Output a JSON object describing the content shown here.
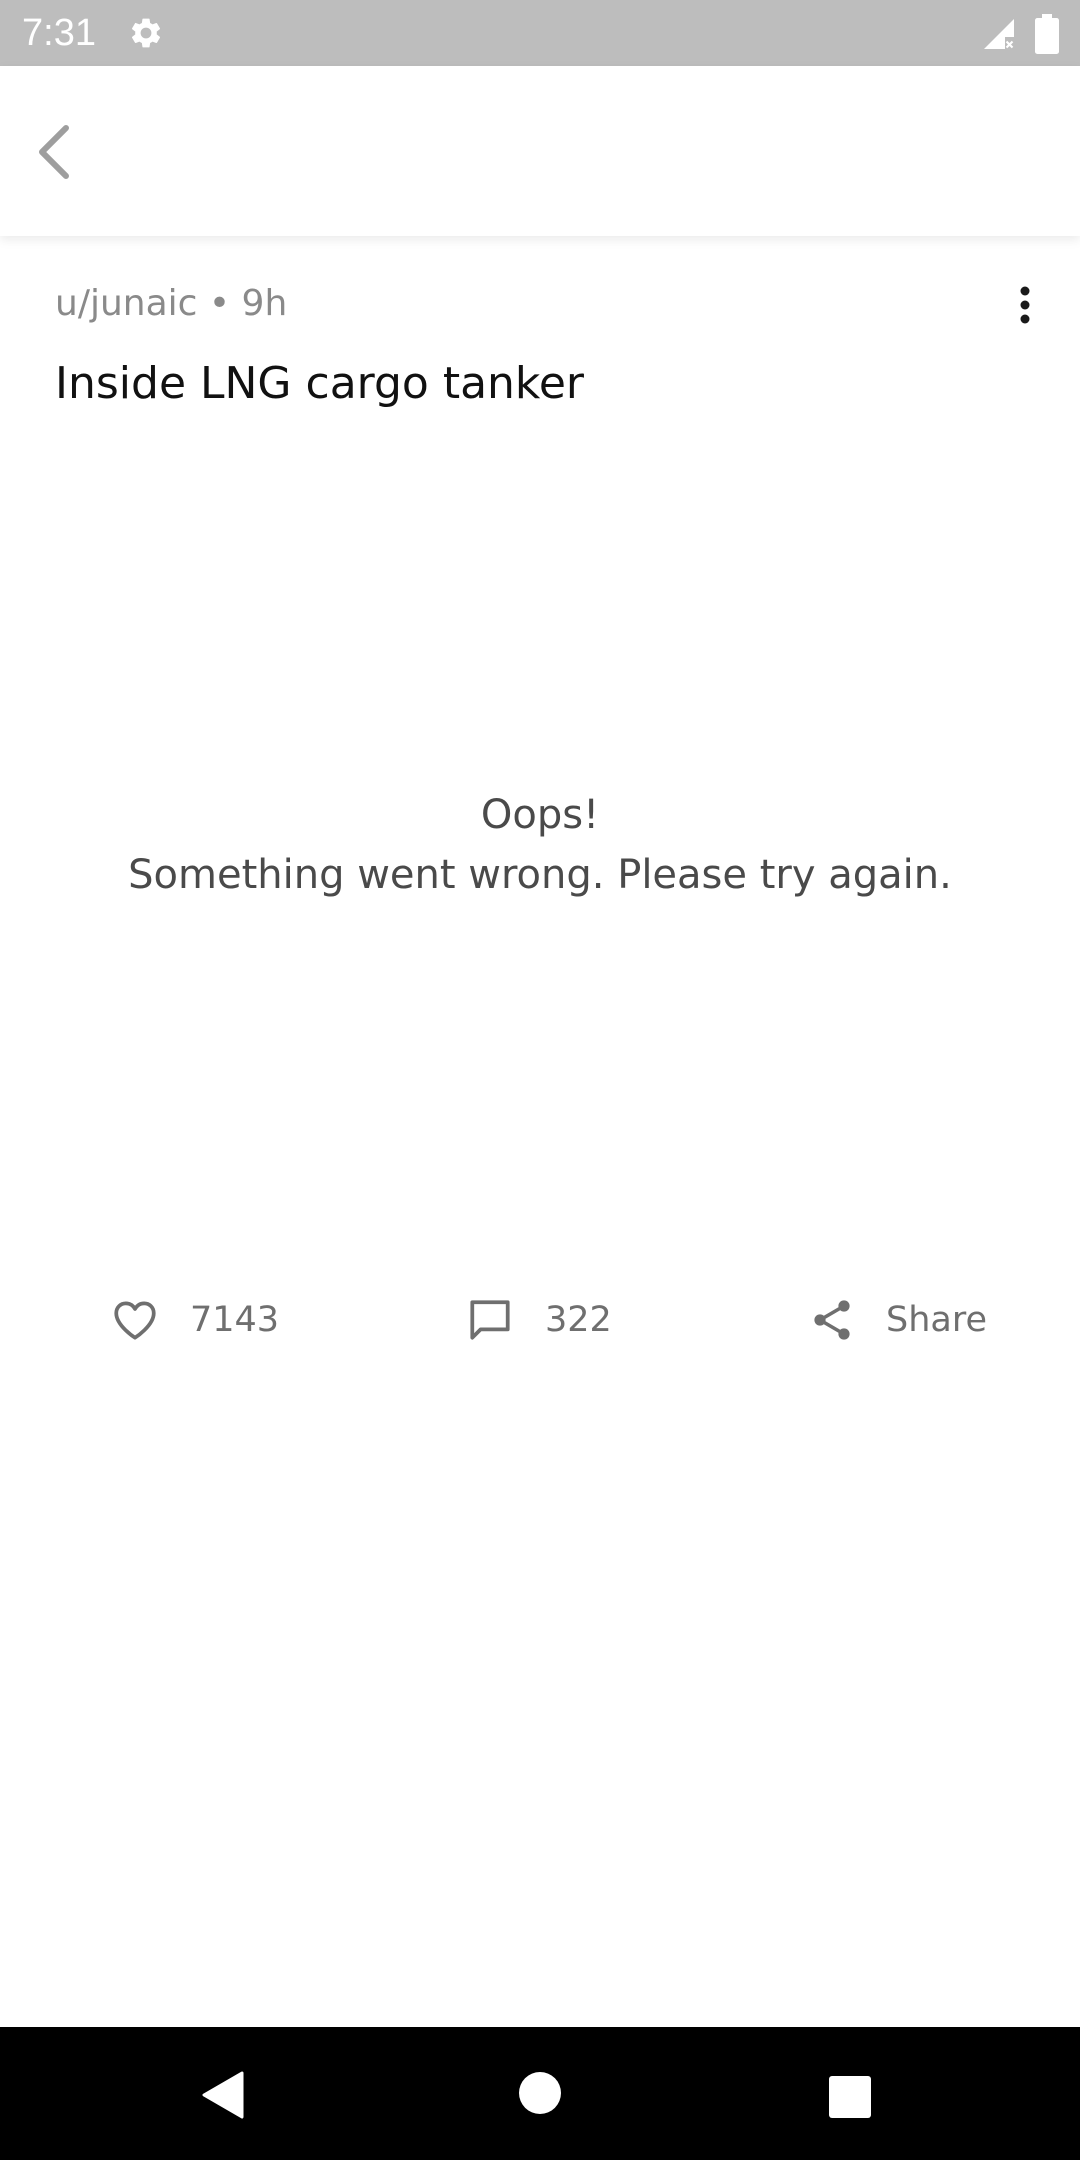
{
  "status_bar": {
    "time": "7:31",
    "icons": [
      "gear-icon",
      "signal-icon",
      "battery-icon"
    ]
  },
  "app_bar": {
    "back_icon": "chevron-left-icon"
  },
  "post": {
    "meta": "u/junaic • 9h",
    "title": "Inside LNG cargo tanker",
    "menu_icon": "more-vert-icon"
  },
  "error": {
    "title": "Oops!",
    "message": "Something went wrong. Please try again."
  },
  "actions": {
    "likes": "7143",
    "comments": "322",
    "share_label": "Share"
  },
  "nav_bar": {
    "buttons": [
      "back-triangle-icon",
      "home-circle-icon",
      "recents-square-icon"
    ]
  },
  "colors": {
    "status_bar_bg": "#bdbdbd",
    "text_primary": "#111111",
    "text_secondary": "#8a8a8a",
    "icon_gray": "#6f6f6f",
    "nav_bar_bg": "#000000"
  }
}
